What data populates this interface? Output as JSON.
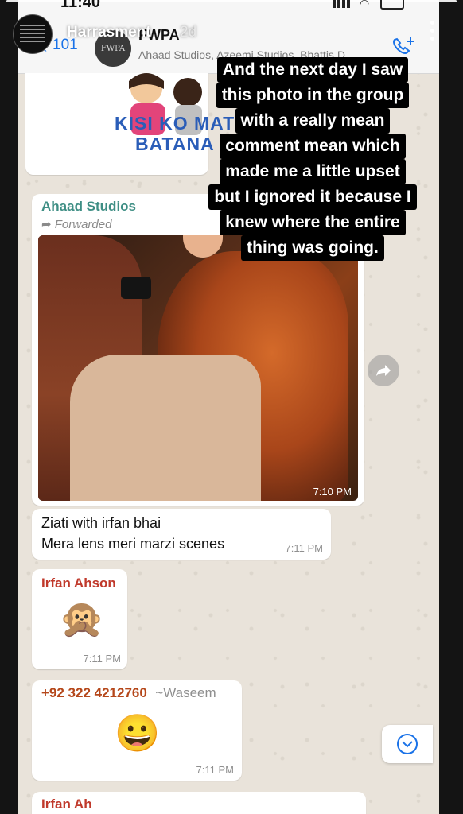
{
  "story": {
    "username": "Harrasment",
    "age": "2d",
    "status_time": "11:40"
  },
  "header": {
    "back_count": "101",
    "group_name": "FWPA",
    "group_avatar_text": "FWPA",
    "members": "Ahaad Studios, Azeemi Studios, Bhattis D..."
  },
  "sticker_text": [
    "KISI KO MAT",
    "BATANA"
  ],
  "caption_lines": [
    "And the next day I saw",
    "this photo in the group",
    "with a really mean",
    "comment mean which",
    "made me a little upset",
    "but I ignored it because I",
    "knew where the entire",
    "thing was going."
  ],
  "messages": {
    "photo": {
      "sender": "Ahaad Studios",
      "forwarded": "Forwarded",
      "time": "7:10 PM"
    },
    "text1": {
      "line1": "Ziati with irfan bhai",
      "line2": "Mera lens meri marzi scenes",
      "time": "7:11 PM"
    },
    "monkey": {
      "sender": "Irfan Ahson",
      "emoji": "🙊",
      "time": "7:11 PM"
    },
    "smile": {
      "sender_phone": "+92 322 4212760",
      "sender_name": "~Waseem",
      "emoji": "😀",
      "time": "7:11 PM"
    },
    "next_sender_partial": "Irfan Ah"
  },
  "colors": {
    "ahaad": "#3e8e84",
    "irfan": "#c0392b",
    "phone": "#b5471a",
    "link": "#1b73e8"
  }
}
